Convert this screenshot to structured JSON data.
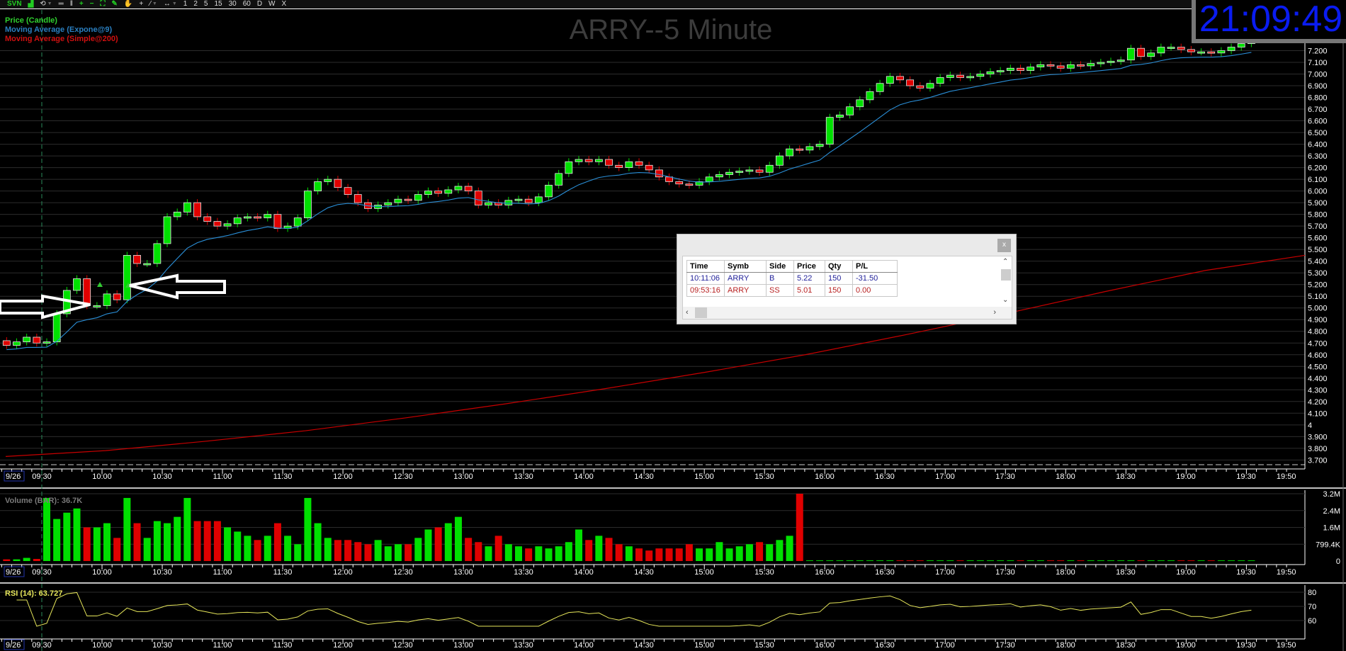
{
  "toolbar": {
    "icons": [
      "svn-icon",
      "area-chart-icon",
      "undo-icon",
      "horizontal-lines-icon",
      "vertical-lines-icon",
      "zoom-in-icon",
      "zoom-out-icon",
      "fit-icon",
      "pencil-icon",
      "hand-icon",
      "crosshair-icon",
      "draw-line-icon",
      "pan-icon"
    ],
    "svn": "SVN",
    "undo": "⟲",
    "hlines": "═",
    "vlines": "‖",
    "zoom_in": "+",
    "zoom_out": "−",
    "fit": "⛶",
    "pencil": "✎",
    "hand": "✋",
    "crosshair": "+",
    "line": "⁄",
    "pan": "↔",
    "intervals": [
      "1",
      "2",
      "5",
      "15",
      "30",
      "60",
      "D",
      "W",
      "X"
    ]
  },
  "legend": {
    "price": "Price (Candle)",
    "ema": "Moving Average (Expone@9)",
    "sma": "Moving Average (Simple@200)"
  },
  "title": "ARRY--5 Minute",
  "clock": "21:09:49",
  "colors": {
    "up": "#00e000",
    "down": "#e00000",
    "ema": "#2a8fd8",
    "sma": "#c80000",
    "rsi": "#e6e65a",
    "clock": "#0a1cf0"
  },
  "volume_label": "Volume (BAR): 36.7K",
  "rsi_label": "RSI (14): 63.727",
  "trade_window": {
    "close": "x",
    "headers": [
      "Time",
      "Symb",
      "Side",
      "Price",
      "Qty",
      "P/L"
    ],
    "rows": [
      [
        "10:11:06",
        "ARRY",
        "B",
        "5.22",
        "150",
        "-31.50"
      ],
      [
        "09:53:16",
        "ARRY",
        "SS",
        "5.01",
        "150",
        "0.00"
      ]
    ]
  },
  "chart_data": {
    "type": "candlestick",
    "title": "ARRY--5 Minute",
    "date_label": "9/26",
    "interval_minutes": 5,
    "first_bar_time": "09:10",
    "session_start": "09:30",
    "price": {
      "first_open": 4.72,
      "closes": [
        4.68,
        4.71,
        4.75,
        4.7,
        4.71,
        4.95,
        5.15,
        5.25,
        5.02,
        5.02,
        5.12,
        5.07,
        5.45,
        5.38,
        5.38,
        5.55,
        5.78,
        5.82,
        5.9,
        5.78,
        5.74,
        5.7,
        5.72,
        5.77,
        5.78,
        5.77,
        5.8,
        5.68,
        5.7,
        5.77,
        6.0,
        6.08,
        6.1,
        6.03,
        5.97,
        5.9,
        5.85,
        5.88,
        5.9,
        5.93,
        5.92,
        5.97,
        6.0,
        5.98,
        6.01,
        6.04,
        6.0,
        5.88,
        5.9,
        5.88,
        5.92,
        5.93,
        5.9,
        5.95,
        6.05,
        6.15,
        6.25,
        6.27,
        6.25,
        6.27,
        6.22,
        6.2,
        6.25,
        6.22,
        6.18,
        6.12,
        6.08,
        6.06,
        6.05,
        6.08,
        6.12,
        6.14,
        6.16,
        6.17,
        6.18,
        6.16,
        6.22,
        6.3,
        6.36,
        6.35,
        6.38,
        6.4,
        6.63,
        6.65,
        6.72,
        6.78,
        6.85,
        6.92,
        6.98,
        6.95,
        6.9,
        6.88,
        6.92,
        6.97,
        6.99,
        6.97,
        6.98,
        7.0,
        7.02,
        7.03,
        7.05,
        7.03,
        7.06,
        7.08,
        7.07,
        7.05,
        7.08,
        7.07,
        7.09,
        7.1,
        7.11,
        7.12,
        7.22,
        7.15,
        7.18,
        7.23,
        7.23,
        7.21,
        7.19,
        7.19,
        7.18,
        7.2,
        7.23,
        7.26,
        7.28
      ]
    },
    "sma200": [
      3.73,
      3.78,
      3.86,
      3.95,
      4.06,
      4.18,
      4.31,
      4.45,
      4.6,
      4.77,
      4.95,
      5.14,
      5.32,
      5.45
    ],
    "volume_millions": [
      0.08,
      0.08,
      0.15,
      0.1,
      3.0,
      2.0,
      2.3,
      2.5,
      1.6,
      1.6,
      1.8,
      1.1,
      3.0,
      1.8,
      1.1,
      1.9,
      1.8,
      2.1,
      3.0,
      1.9,
      1.9,
      1.9,
      1.6,
      1.4,
      1.2,
      1.0,
      1.2,
      1.8,
      1.2,
      0.8,
      3.0,
      1.8,
      1.1,
      1.0,
      1.0,
      0.9,
      0.8,
      1.0,
      0.7,
      0.8,
      0.8,
      1.1,
      1.5,
      1.6,
      1.8,
      2.1,
      1.1,
      0.9,
      0.7,
      1.2,
      0.8,
      0.7,
      0.6,
      0.7,
      0.6,
      0.7,
      0.9,
      1.5,
      1.0,
      1.2,
      1.1,
      0.8,
      0.7,
      0.6,
      0.5,
      0.6,
      0.6,
      0.6,
      0.8,
      0.6,
      0.6,
      0.9,
      0.6,
      0.7,
      0.8,
      0.9,
      0.8,
      1.0,
      1.2,
      3.2
    ],
    "price_axis": [
      "7.200",
      "7.100",
      "7.000",
      "6.900",
      "6.800",
      "6.700",
      "6.600",
      "6.500",
      "6.400",
      "6.300",
      "6.200",
      "6.100",
      "6.000",
      "5.900",
      "5.800",
      "5.700",
      "5.600",
      "5.500",
      "5.400",
      "5.300",
      "5.200",
      "5.100",
      "5.000",
      "4.900",
      "4.800",
      "4.700",
      "4.600",
      "4.500",
      "4.400",
      "4.300",
      "4.200",
      "4.100",
      "4",
      "3.900",
      "3.800",
      "3.700"
    ],
    "volume_axis": [
      {
        "label": "3.2M",
        "value": 3.2
      },
      {
        "label": "2.4M",
        "value": 2.4
      },
      {
        "label": "1.6M",
        "value": 1.6
      },
      {
        "label": "799.4K",
        "value": 0.7994
      },
      {
        "label": "0",
        "value": 0
      }
    ],
    "rsi_axis": [
      {
        "label": "80",
        "value": 80
      },
      {
        "label": "70",
        "value": 70
      },
      {
        "label": "60",
        "value": 60
      }
    ],
    "time_labels": [
      "09:30",
      "10:00",
      "10:30",
      "11:00",
      "11:30",
      "12:00",
      "12:30",
      "13:00",
      "13:30",
      "14:00",
      "14:30",
      "15:00",
      "15:30",
      "16:00",
      "16:30",
      "17:00",
      "17:30",
      "18:00",
      "18:30",
      "19:00",
      "19:30",
      "19:50"
    ]
  }
}
